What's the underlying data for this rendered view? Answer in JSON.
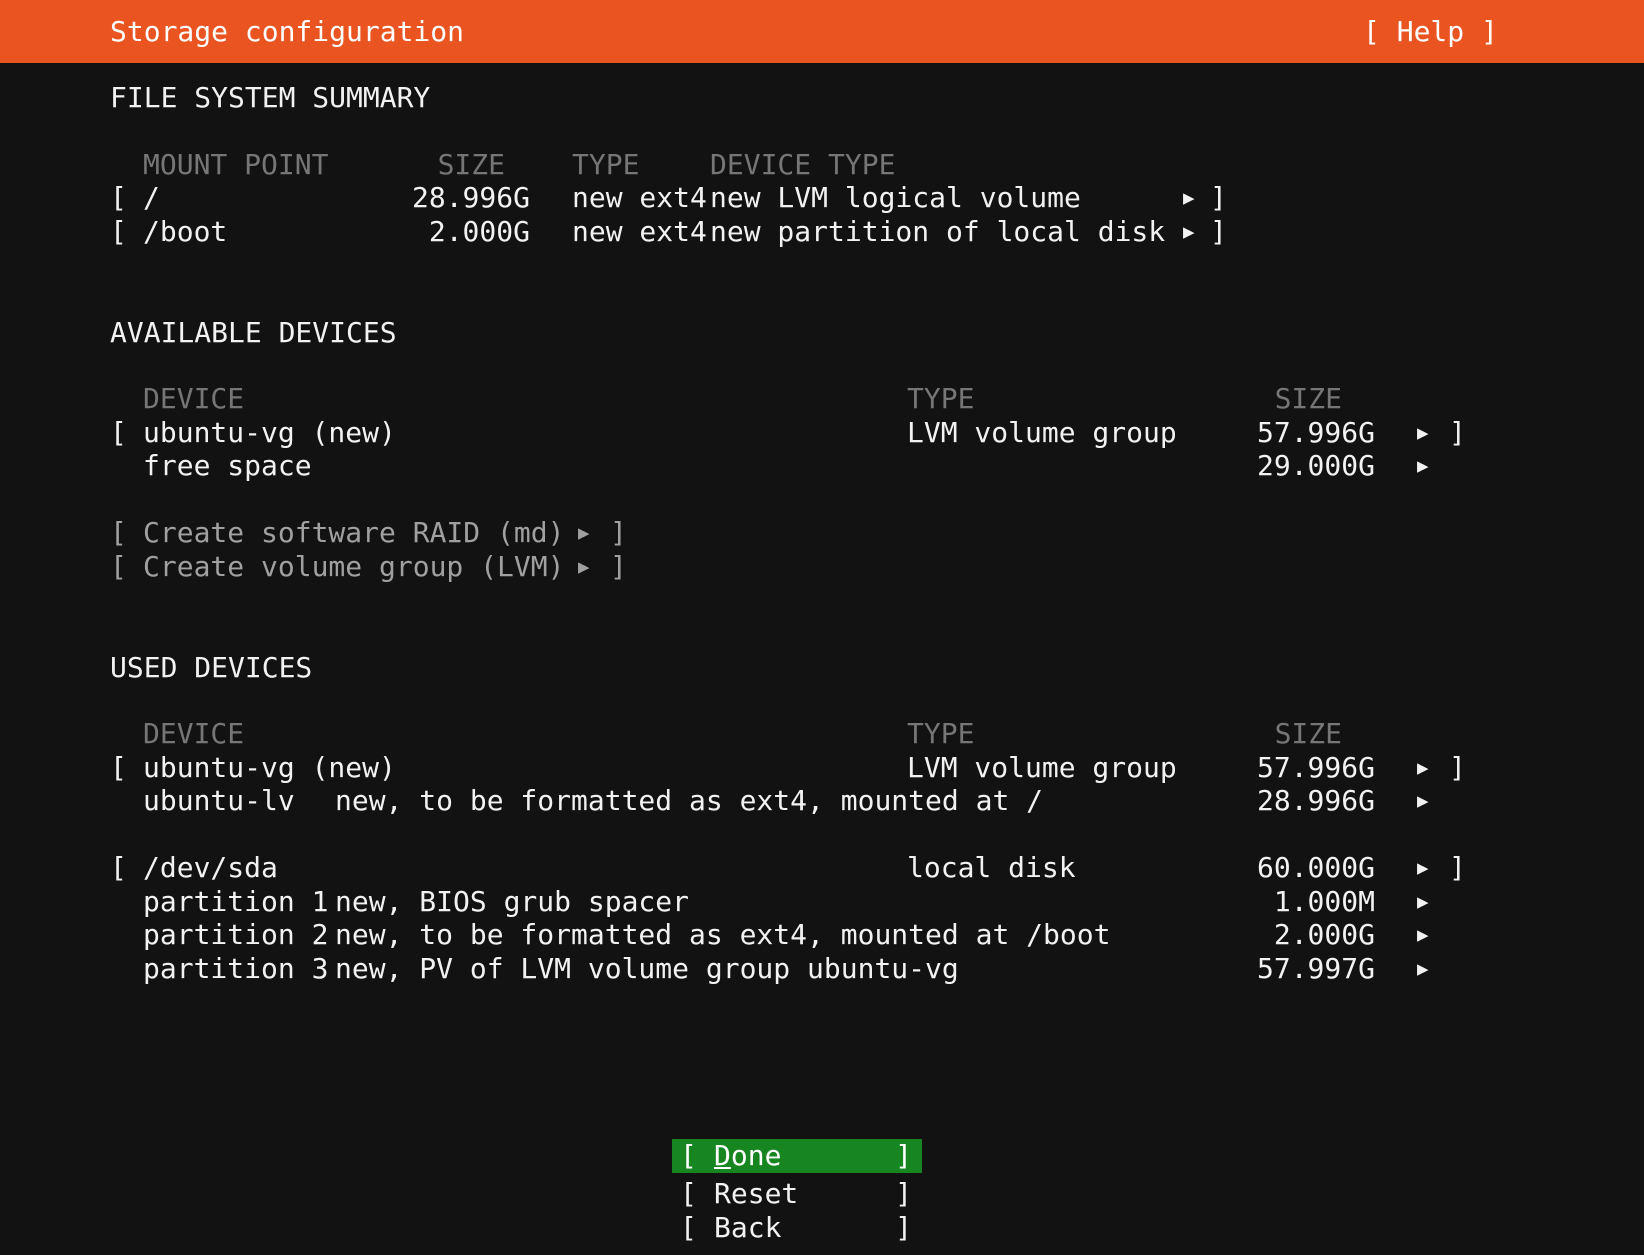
{
  "window": {
    "title": "Storage configuration",
    "help_label": "[ Help ]"
  },
  "glyphs": {
    "lb": "[",
    "rb": "]",
    "arrow": "▶"
  },
  "colors": {
    "header_bg": "#e95420",
    "screen_bg": "#121212",
    "text": "#f2f2f2",
    "muted_header": "#767676",
    "disabled_text": "#a0a0a0",
    "focus_green": "#178621"
  },
  "fs_summary": {
    "section_title": "FILE SYSTEM SUMMARY",
    "columns": {
      "mount": "MOUNT POINT",
      "size": "SIZE",
      "type": "TYPE",
      "device_type": "DEVICE TYPE"
    },
    "rows": [
      {
        "mount": "/",
        "size": "28.996G",
        "type": "new ext4",
        "device_type": "new LVM logical volume"
      },
      {
        "mount": "/boot",
        "size": "2.000G",
        "type": "new ext4",
        "device_type": "new partition of local disk"
      }
    ]
  },
  "available_devices": {
    "section_title": "AVAILABLE DEVICES",
    "columns": {
      "device": "DEVICE",
      "type": "TYPE",
      "size": "SIZE"
    },
    "rows": [
      {
        "name": "ubuntu-vg (new)",
        "type": "LVM volume group",
        "size": "57.996G"
      },
      {
        "name": "free space",
        "size": "29.000G"
      }
    ],
    "actions": [
      {
        "label": "Create software RAID (md)"
      },
      {
        "label": "Create volume group (LVM)"
      }
    ]
  },
  "used_devices": {
    "section_title": "USED DEVICES",
    "columns": {
      "device": "DEVICE",
      "type": "TYPE",
      "size": "SIZE"
    },
    "groups": [
      {
        "rows": [
          {
            "name": "ubuntu-vg (new)",
            "type": "LVM volume group",
            "size": "57.996G"
          },
          {
            "name": "ubuntu-lv",
            "desc": "new, to be formatted as ext4, mounted at /",
            "size": "28.996G"
          }
        ]
      },
      {
        "rows": [
          {
            "name": "/dev/sda",
            "type": "local disk",
            "size": "60.000G"
          },
          {
            "name": "partition 1",
            "desc": "new, BIOS grub spacer",
            "size": "1.000M"
          },
          {
            "name": "partition 2",
            "desc": "new, to be formatted as ext4, mounted at /boot",
            "size": "2.000G"
          },
          {
            "name": "partition 3",
            "desc": "new, PV of LVM volume group ubuntu-vg",
            "size": "57.997G"
          }
        ]
      }
    ]
  },
  "buttons": {
    "done": "Done",
    "reset": "Reset",
    "back": "Back"
  }
}
